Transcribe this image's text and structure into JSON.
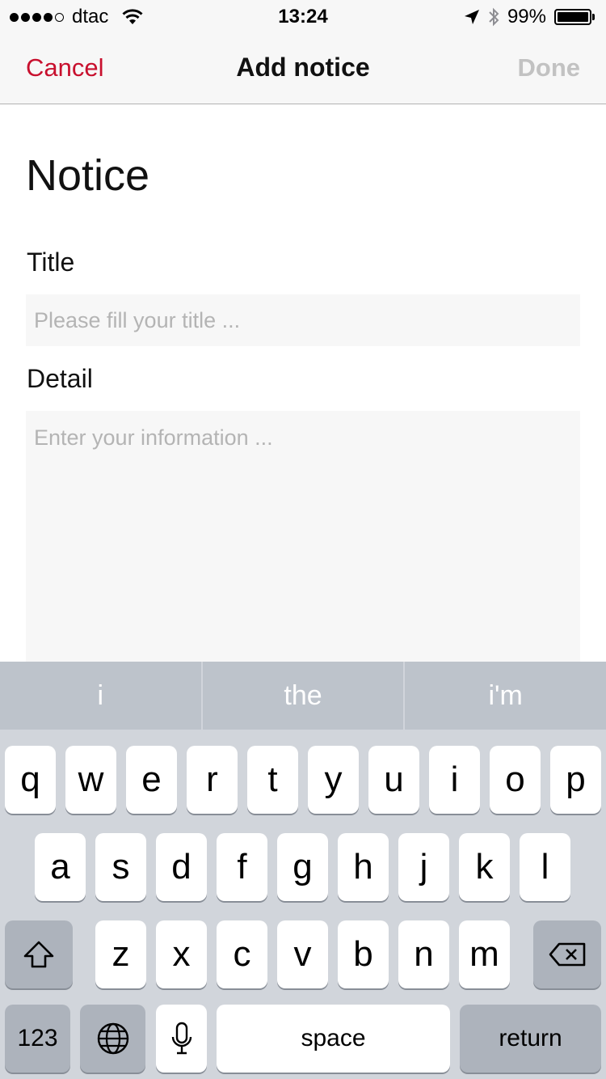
{
  "status_bar": {
    "carrier": "dtac",
    "time": "13:24",
    "battery": "99%",
    "battery_level": 0.99,
    "icons": [
      "signal-dots-icon",
      "wifi-icon",
      "location-arrow-icon",
      "bluetooth-icon",
      "battery-icon"
    ]
  },
  "nav": {
    "cancel_label": "Cancel",
    "title": "Add notice",
    "done_label": "Done"
  },
  "form": {
    "heading": "Notice",
    "title_label": "Title",
    "title_value": "",
    "title_placeholder": "Please fill your title ...",
    "detail_label": "Detail",
    "detail_value": "",
    "detail_placeholder": "Enter your information ..."
  },
  "keyboard": {
    "suggestions": [
      "i",
      "the",
      "i'm"
    ],
    "row1": [
      "q",
      "w",
      "e",
      "r",
      "t",
      "y",
      "u",
      "i",
      "o",
      "p"
    ],
    "row2": [
      "a",
      "s",
      "d",
      "f",
      "g",
      "h",
      "j",
      "k",
      "l"
    ],
    "row3": [
      "z",
      "x",
      "c",
      "v",
      "b",
      "n",
      "m"
    ],
    "numbers_label": "123",
    "space_label": "space",
    "return_label": "return",
    "icons": [
      "shift-icon",
      "backspace-icon",
      "globe-icon",
      "microphone-icon"
    ]
  },
  "colors": {
    "accent": "#c8102e",
    "done_disabled": "#c2c2c2",
    "field_background": "#f7f7f7",
    "keyboard_background": "#d1d5db"
  }
}
